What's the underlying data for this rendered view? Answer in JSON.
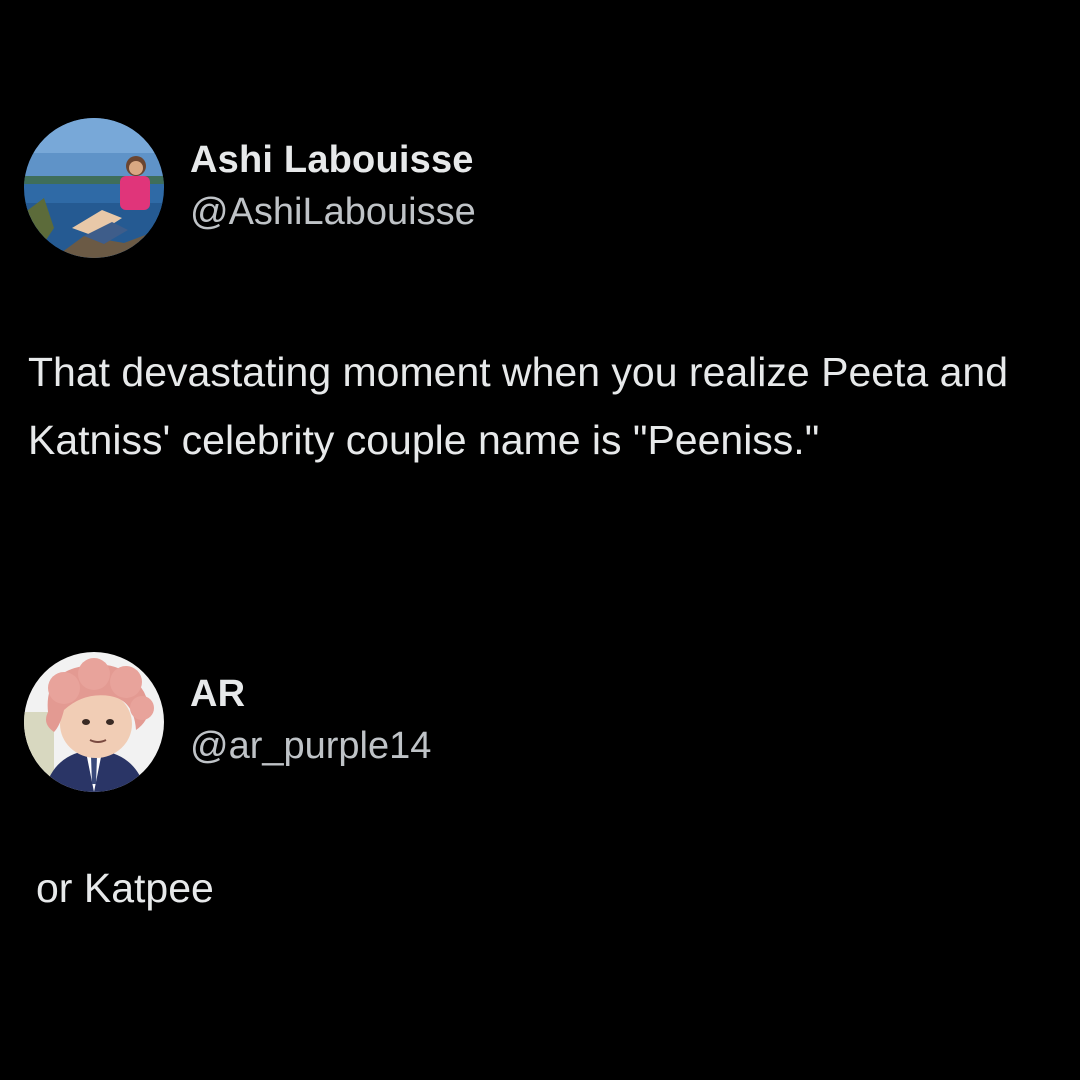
{
  "tweets": [
    {
      "display_name": "Ashi Labouisse",
      "handle": "@AshiLabouisse",
      "text": "That devastating moment when you realize Peeta and Katniss' celebrity couple name is \"Peeniss.\""
    },
    {
      "display_name": "AR",
      "handle": "@ar_purple14",
      "text": "or Katpee"
    }
  ],
  "colors": {
    "background": "#000000",
    "primary_text": "#e7e9ea",
    "secondary_text": "#bfc3c7"
  }
}
